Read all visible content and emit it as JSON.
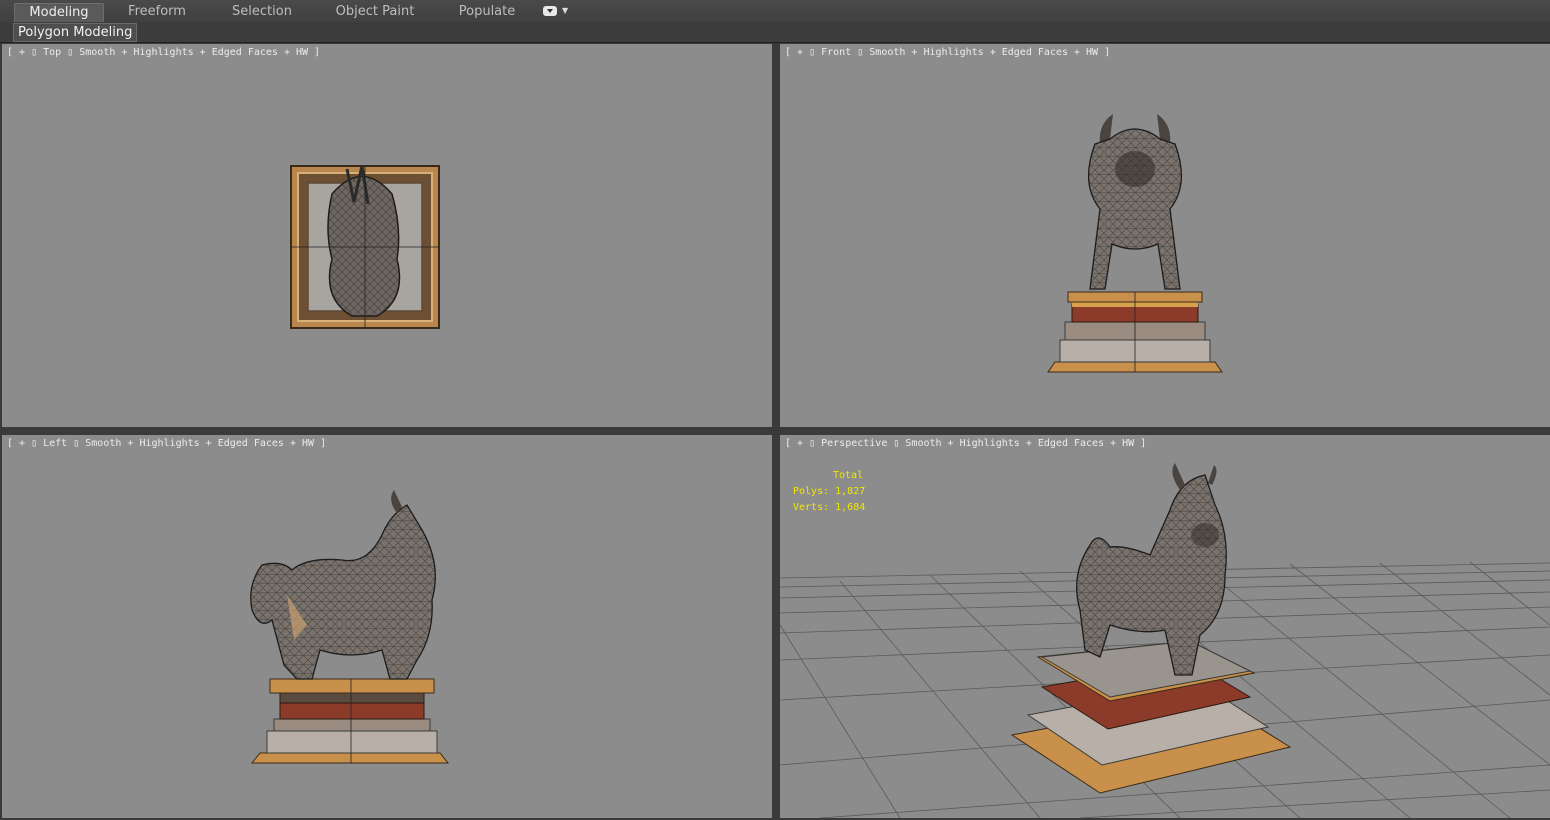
{
  "ribbon": {
    "tabs": [
      {
        "label": "Modeling",
        "active": true
      },
      {
        "label": "Freeform"
      },
      {
        "label": "Selection"
      },
      {
        "label": "Object Paint"
      },
      {
        "label": "Populate"
      }
    ],
    "menu_icon": "dropdown-toggle-icon"
  },
  "subbar": {
    "panel_label": "Polygon Modeling"
  },
  "viewports": {
    "top": {
      "label": "[ + ▯ Top ▯ Smooth + Highlights + Edged Faces + HW ]"
    },
    "front": {
      "label": "[ + ▯ Front ▯ Smooth + Highlights + Edged Faces + HW ]"
    },
    "left": {
      "label": "[ + ▯ Left ▯ Smooth + Highlights + Edged Faces + HW ]"
    },
    "perspective": {
      "label": "[ + ▯ Perspective ▯ Smooth + Highlights + Edged Faces + HW ]",
      "stats": {
        "header": "Total",
        "polys": "Polys: 1,827",
        "verts": "Verts: 1,684"
      }
    }
  },
  "colors": {
    "viewport_bg": "#8c8c8c",
    "stats_text": "#f2e600",
    "pedestal_gold": "#c8904a",
    "stone": "#8a8078"
  }
}
